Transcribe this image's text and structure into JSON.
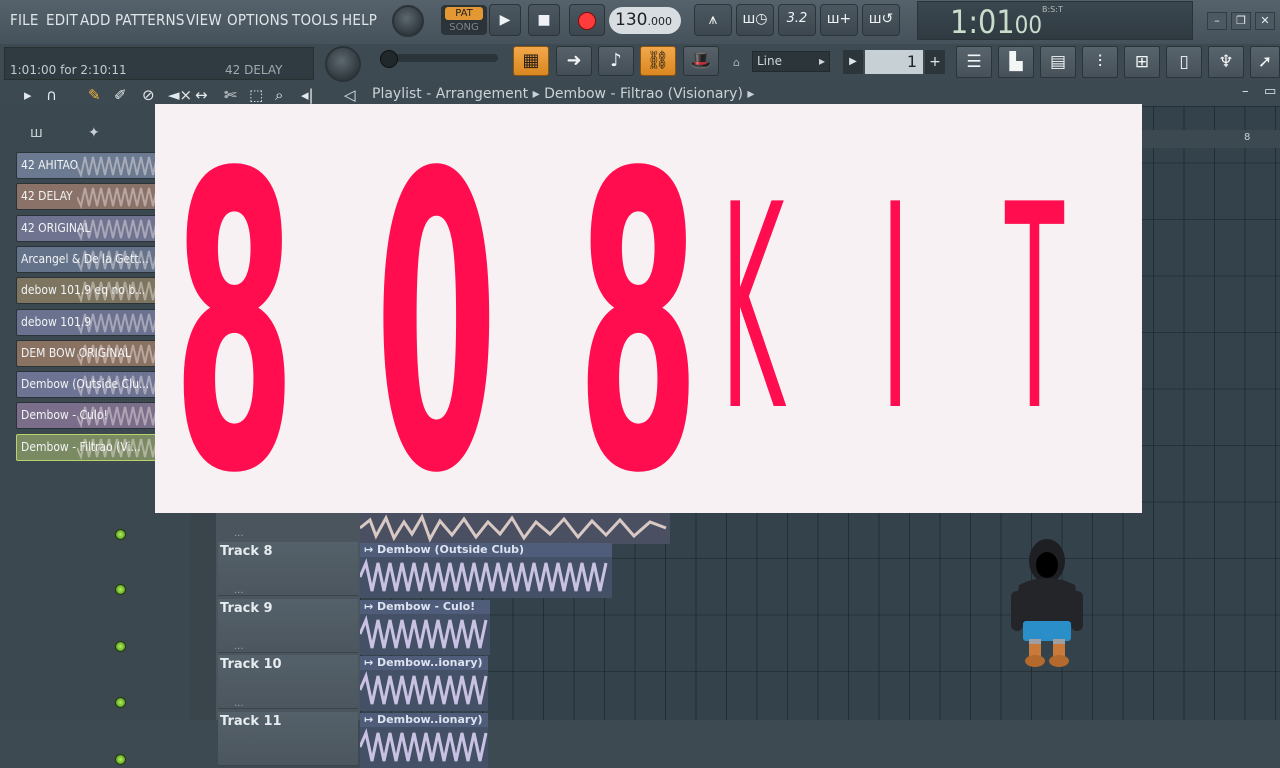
{
  "menu": [
    "FILE",
    "EDIT",
    "ADD",
    "PATTERNS",
    "VIEW",
    "OPTIONS",
    "TOOLS",
    "HELP"
  ],
  "transport": {
    "pat_label": "PAT",
    "song_label": "SONG",
    "tempo": "130",
    "tempo_decimal": ".000"
  },
  "clock": {
    "time": "1:01",
    "subtime": "00",
    "unit": "B:S:T"
  },
  "hint": {
    "position": "1:01:00 for 2:10:11",
    "current_sample": "42 DELAY"
  },
  "snap": {
    "mode": "Line",
    "step": "1"
  },
  "playlist": {
    "breadcrumb": "Playlist - Arrangement",
    "pattern": "Dembow - Filtrao (Visionary)",
    "ruler_mark": "8"
  },
  "browser_clips": [
    {
      "label": "42 AHITAO",
      "color": "#6b7a90"
    },
    {
      "label": "42 DELAY",
      "color": "#8a7268"
    },
    {
      "label": "42 ORIGINAL",
      "color": "#6f7390"
    },
    {
      "label": "Arcangel & De la Gett...",
      "color": "#65738a"
    },
    {
      "label": "debow 101.9 eq no b...",
      "color": "#7d7560"
    },
    {
      "label": "debow 101.9",
      "color": "#6a7290"
    },
    {
      "label": "DEM BOW ORIGINAL",
      "color": "#8a7263"
    },
    {
      "label": "Dembow (Outside Clu...",
      "color": "#6d7493"
    },
    {
      "label": "Dembow - Culo!",
      "color": "#7a6e8b"
    },
    {
      "label": "Dembow - Filtrao (Vi...",
      "color": "#7a8a63"
    }
  ],
  "tracks": [
    {
      "name": "Track 8",
      "dots": "...",
      "clip": "Dembow (Outside Club)"
    },
    {
      "name": "Track 9",
      "dots": "...",
      "clip": "Dembow - Culo!"
    },
    {
      "name": "Track 10",
      "dots": "...",
      "clip": "Dembow..ionary)"
    },
    {
      "name": "Track 11",
      "dots": "...",
      "clip": "Dembow..ionary)"
    }
  ],
  "overlay": {
    "chars": [
      "8",
      "0",
      "8",
      "K",
      "I",
      "T"
    ],
    "color": "#ff0d4f",
    "background": "#f8f1f4"
  },
  "window_buttons": [
    "–",
    "❐",
    "✕"
  ]
}
